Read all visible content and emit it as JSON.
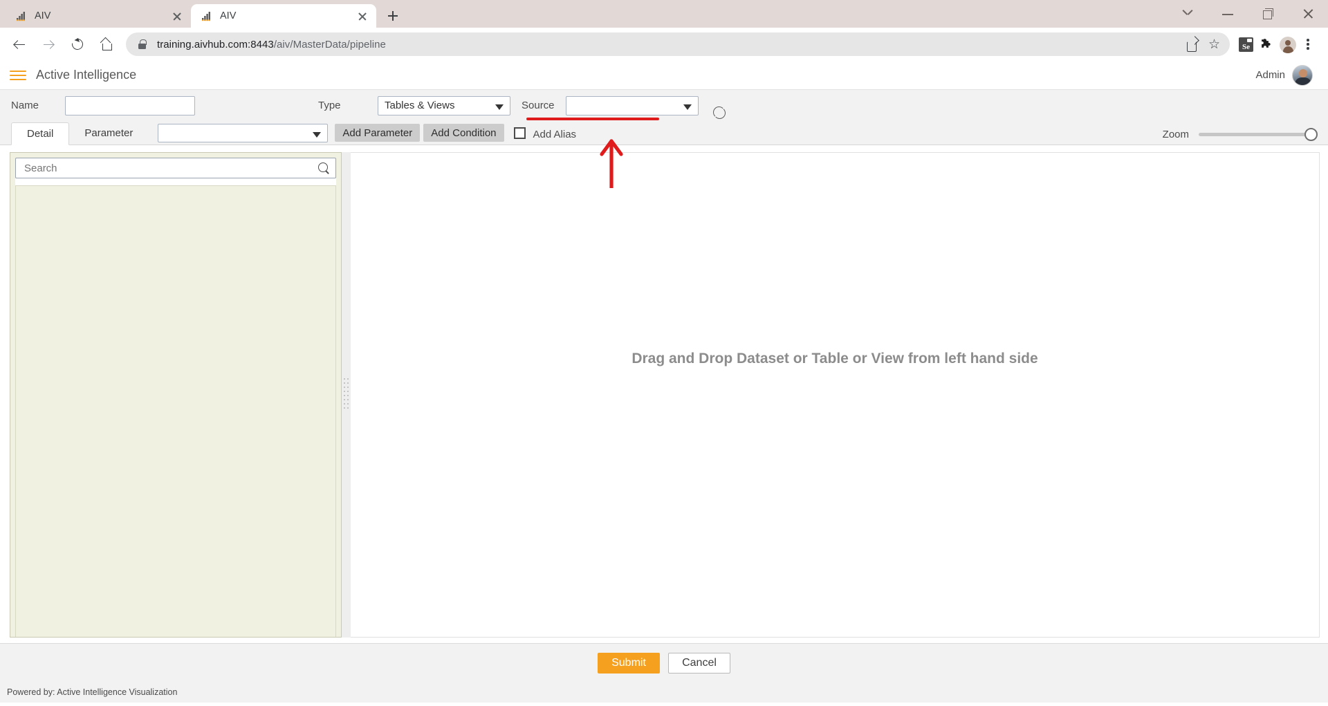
{
  "browser": {
    "tabs": [
      {
        "title": "AIV",
        "favicon": "bar-chart-favicon",
        "active": false
      },
      {
        "title": "AIV",
        "favicon": "bar-chart-favicon",
        "active": true
      }
    ],
    "new_tab_label": "+",
    "window_controls": [
      "tab-search-chevron",
      "minimize",
      "maximize",
      "close"
    ],
    "nav": {
      "back": "back-arrow",
      "forward": "forward-arrow",
      "reload": "reload-icon",
      "home": "home-icon"
    },
    "omnibox": {
      "lock": "lock-icon",
      "url_domain": "training.aivhub.com:8443",
      "url_path": "/aiv/MasterData/pipeline",
      "share": "share-icon",
      "bookmark": "star-icon"
    },
    "extensions": [
      {
        "name": "selenium-ide-icon",
        "label": "Se"
      },
      {
        "name": "extensions-puzzle-icon",
        "label": "❖"
      },
      {
        "name": "profile-avatar-icon",
        "label": ""
      },
      {
        "name": "chrome-menu-icon",
        "label": ""
      }
    ]
  },
  "app": {
    "header": {
      "menu_icon": "hamburger-menu-icon",
      "title": "Active Intelligence",
      "user_name": "Admin",
      "avatar": "user-avatar"
    },
    "form": {
      "name_label": "Name",
      "name_value": "",
      "name_placeholder": "",
      "type_label": "Type",
      "type_value": "Tables & Views",
      "source_label": "Source",
      "source_value": "",
      "refresh_icon": "refresh-icon"
    },
    "tabs": [
      {
        "label": "Detail",
        "active": true
      },
      {
        "label": "Parameter",
        "active": false
      }
    ],
    "toolbar": {
      "tab_select_value": "",
      "add_parameter_label": "Add Parameter",
      "add_condition_label": "Add Condition",
      "add_alias_label": "Add Alias",
      "add_alias_checked": false,
      "zoom_label": "Zoom",
      "zoom_value": 100
    },
    "left_panel": {
      "search_placeholder": "Search",
      "search_value": "",
      "search_icon": "search-icon",
      "tree_items": []
    },
    "canvas": {
      "drop_message": "Drag and Drop Dataset or Table or View from left hand side"
    },
    "footer": {
      "submit_label": "Submit",
      "cancel_label": "Cancel",
      "powered_by": "Powered by: Active Intelligence Visualization"
    }
  },
  "annotation": {
    "arrow_color": "#e01b1b",
    "underline_color": "#e01b1b",
    "target": "source-dropdown"
  },
  "colors": {
    "accent_orange": "#f5a01e",
    "tabstrip": "#e2d9d6",
    "panel_cream": "#f1f1e2",
    "toolbar_gray": "#f2f2f2",
    "annotation_red": "#e01b1b"
  }
}
